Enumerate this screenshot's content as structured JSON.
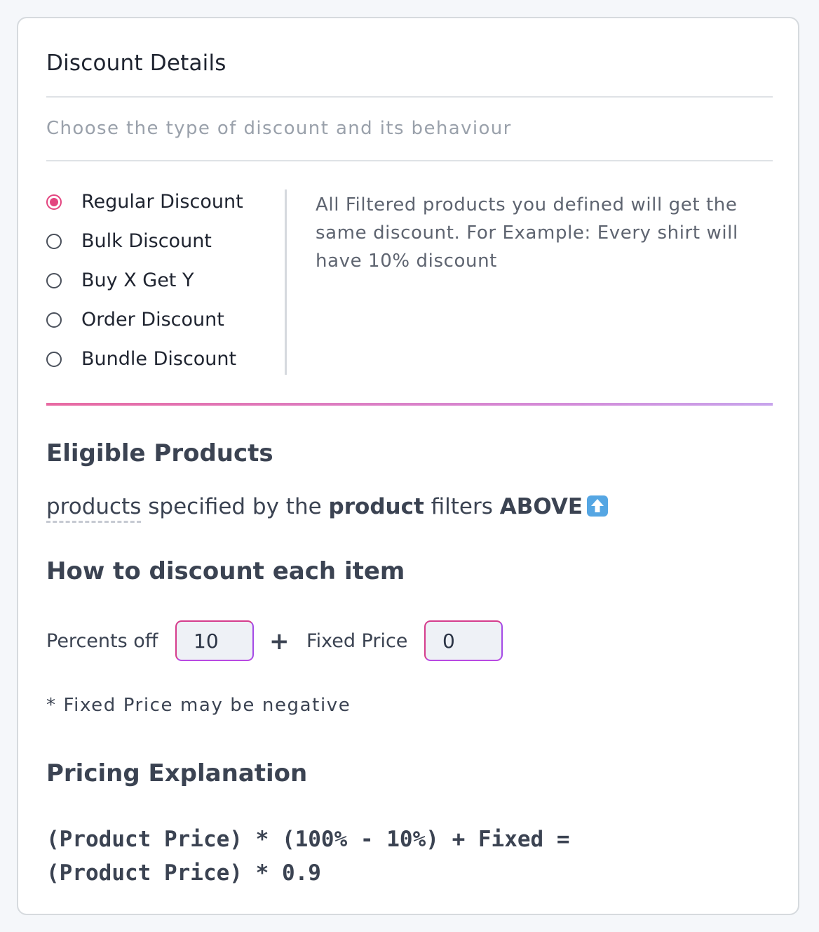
{
  "panel": {
    "title": "Discount Details",
    "subtitle": "Choose the type of discount and its behaviour"
  },
  "discount_types": {
    "selected": "Regular Discount",
    "options": [
      {
        "label": "Regular Discount",
        "checked": true
      },
      {
        "label": "Bulk Discount",
        "checked": false
      },
      {
        "label": "Buy X Get Y",
        "checked": false
      },
      {
        "label": "Order Discount",
        "checked": false
      },
      {
        "label": "Bundle Discount",
        "checked": false
      }
    ],
    "description": "All Filtered products you defined will get the same discount. For Example: Every shirt will have 10% discount"
  },
  "eligible": {
    "heading": "Eligible Products",
    "text_products": "products",
    "text_specified": " specified by the ",
    "text_product_bold": "product",
    "text_filters": " filters ",
    "text_above": "ABOVE",
    "icon": "up-arrow-icon"
  },
  "how": {
    "heading": "How to discount each item",
    "percents_label": "Percents off",
    "percents_value": "10",
    "plus": "+",
    "fixed_label": "Fixed Price",
    "fixed_value": "0",
    "note": "* Fixed Price may be negative"
  },
  "pricing": {
    "heading": "Pricing Explanation",
    "line1": "(Product Price) * (100% - 10%) + Fixed =",
    "line2": "(Product Price) * 0.9"
  },
  "colors": {
    "accent": "#e3447f",
    "gradient_start": "#e86aa2",
    "gradient_end": "#c8a4ec"
  }
}
